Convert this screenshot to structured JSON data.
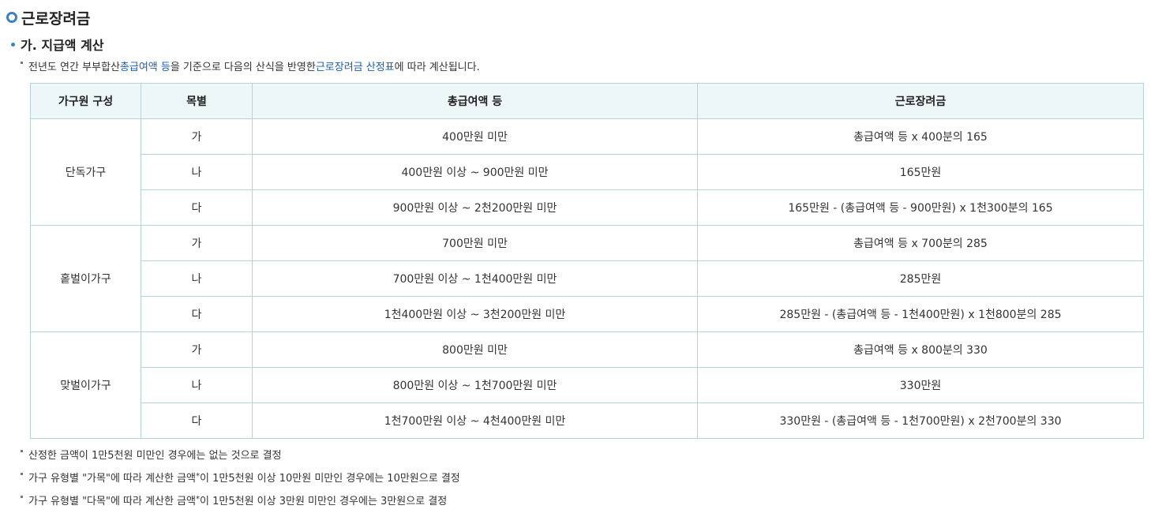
{
  "section_title": "근로장려금",
  "subsection_title": "가. 지급액 계산",
  "intro": {
    "pre": "전년도 연간 부부합산 ",
    "link1": "총급여액 등",
    "mid": "을 기준으로 다음의 산식을 반영한 ",
    "link2": "근로장려금 산정표",
    "post": "에 따라 계산됩니다."
  },
  "table": {
    "headers": [
      "가구원 구성",
      "목별",
      "총급여액 등",
      "근로장려금"
    ],
    "groups": [
      {
        "name": "단독가구",
        "rows": [
          {
            "type": "가",
            "income": "400만원 미만",
            "amount": "총급여액 등 x 400분의 165"
          },
          {
            "type": "나",
            "income": "400만원 이상 ~ 900만원 미만",
            "amount": "165만원"
          },
          {
            "type": "다",
            "income": "900만원 이상 ~ 2천200만원 미만",
            "amount": "165만원 - (총급여액 등 - 900만원) x 1천300분의 165"
          }
        ]
      },
      {
        "name": "홑벌이가구",
        "rows": [
          {
            "type": "가",
            "income": "700만원 미만",
            "amount": "총급여액 등 x 700분의 285"
          },
          {
            "type": "나",
            "income": "700만원 이상 ~ 1천400만원 미만",
            "amount": "285만원"
          },
          {
            "type": "다",
            "income": "1천400만원 이상 ~ 3천200만원 미만",
            "amount": "285만원 - (총급여액 등 - 1천400만원) x 1천800분의 285"
          }
        ]
      },
      {
        "name": "맞벌이가구",
        "rows": [
          {
            "type": "가",
            "income": "800만원 미만",
            "amount": "총급여액 등 x 800분의 330"
          },
          {
            "type": "나",
            "income": "800만원 이상 ~ 1천700만원 미만",
            "amount": "330만원"
          },
          {
            "type": "다",
            "income": "1천700만원 이상 ~ 4천400만원 미만",
            "amount": "330만원 - (총급여액 등 - 1천700만원) x 2천700분의 330"
          }
        ]
      }
    ]
  },
  "footnotes": {
    "note1": "산정한 금액이 1만5천원 미만인 경우에는 없는 것으로 결정",
    "note2_pre": "가구 유형별 \"가목\"에 따라 계산한 금액",
    "note2_sup": "*",
    "note2_post": "이 1만5천원 이상 10만원 미만인 경우에는 10만원으로 결정",
    "note3_pre": "가구 유형별 \"다목\"에 따라 계산한 금액",
    "note3_sup": "*",
    "note3_post": "이 1만5천원 이상 3만원 미만인 경우에는 3만원으로 결정"
  }
}
